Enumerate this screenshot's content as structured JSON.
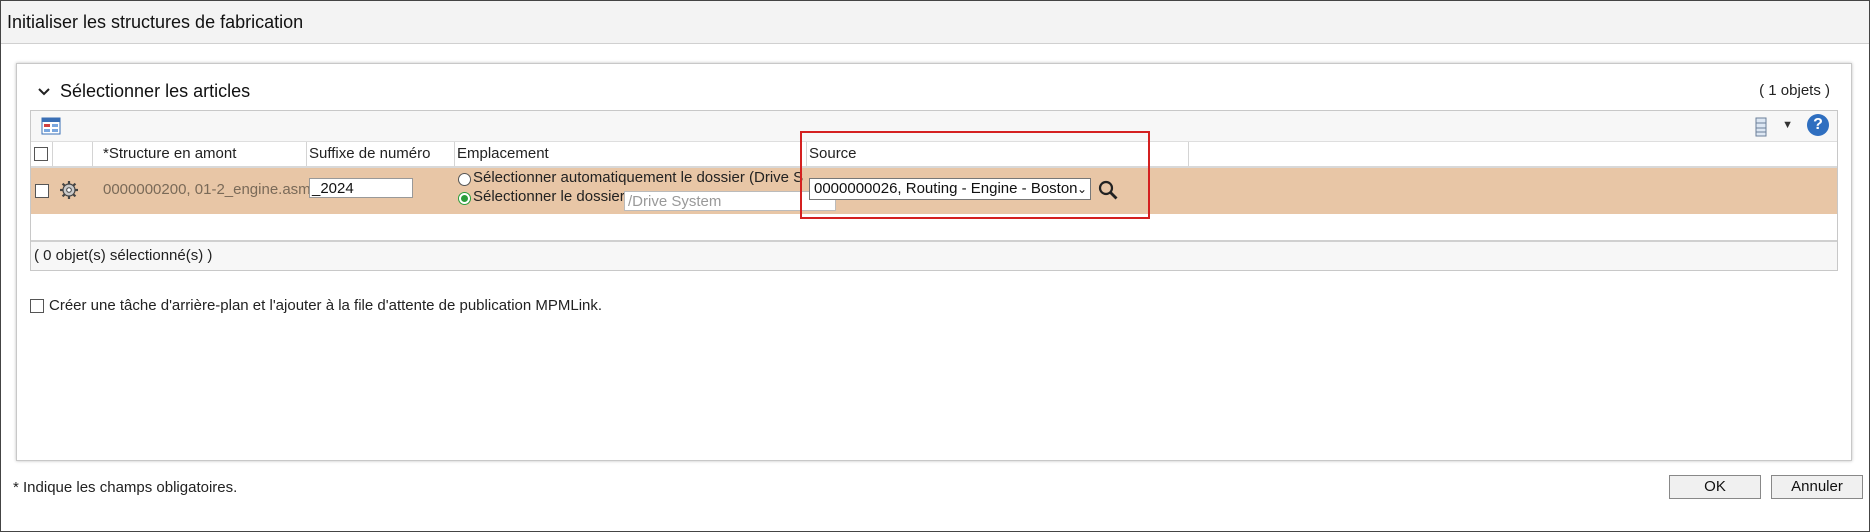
{
  "window": {
    "title": "Initialiser les structures de fabrication"
  },
  "section": {
    "title": "Sélectionner les articles",
    "object_count": "( 1 objets )"
  },
  "toolbar": {
    "help_label": "?"
  },
  "table": {
    "columns": [
      "*Structure en amont",
      "Suffixe de numéro",
      "Emplacement",
      "Source"
    ],
    "row": {
      "structure": "0000000200, 01-2_engine.asm,",
      "suffix": "_2024",
      "location_auto_label": "Sélectionner automatiquement le dossier (Drive S",
      "location_select_label": "Sélectionner le dossier",
      "folder_value": "/Drive System",
      "source_value": "0000000026, Routing - Engine - Boston"
    },
    "selected_count": "( 0 objet(s) sélectionné(s) )"
  },
  "background_task_label": "Créer une tâche d'arrière-plan et l'ajouter à la file d'attente de publication MPMLink.",
  "required_note": "* Indique les champs obligatoires.",
  "buttons": {
    "ok": "OK",
    "cancel": "Annuler"
  },
  "colors": {
    "row_highlight": "#e8c6a6",
    "annotation_box": "#d42020",
    "selected_radio": "#2a9d3a"
  }
}
